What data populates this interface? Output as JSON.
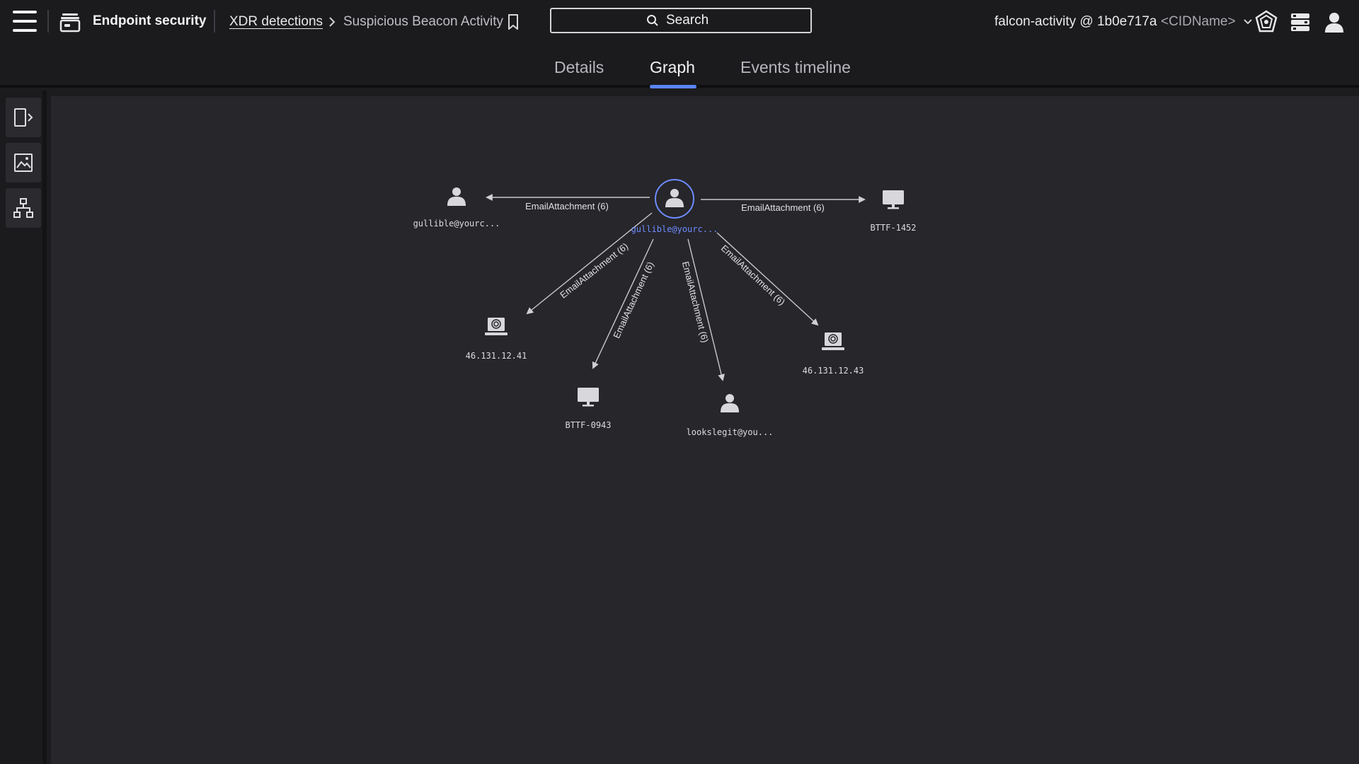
{
  "header": {
    "app_name": "Endpoint security",
    "breadcrumb_link": "XDR detections",
    "breadcrumb_current": "Suspicious Beacon Activity",
    "search_placeholder": "Search",
    "account": "falcon-activity @ 1b0e717a",
    "cid": "<CIDName>"
  },
  "tabs": [
    {
      "label": "Details",
      "active": false
    },
    {
      "label": "Graph",
      "active": true
    },
    {
      "label": "Events timeline",
      "active": false
    }
  ],
  "colors": {
    "accent": "#5a86ff",
    "background": "#26262b",
    "center_node": "#6f8cff"
  },
  "graph": {
    "center": {
      "label": "gullible@yourc...",
      "type": "user"
    },
    "nodes": [
      {
        "label": "gullible@yourc...",
        "type": "user",
        "edge_label": "EmailAttachment (6)"
      },
      {
        "label": "BTTF-1452",
        "type": "host",
        "edge_label": "EmailAttachment (6)"
      },
      {
        "label": "46.131.12.41",
        "type": "ip",
        "edge_label": "EmailAttachment (6)"
      },
      {
        "label": "BTTF-0943",
        "type": "host",
        "edge_label": "EmailAttachment (6)"
      },
      {
        "label": "lookslegit@you...",
        "type": "user",
        "edge_label": "EmailAttachment (6)"
      },
      {
        "label": "46.131.12.43",
        "type": "ip",
        "edge_label": "EmailAttachment (6)"
      }
    ]
  }
}
